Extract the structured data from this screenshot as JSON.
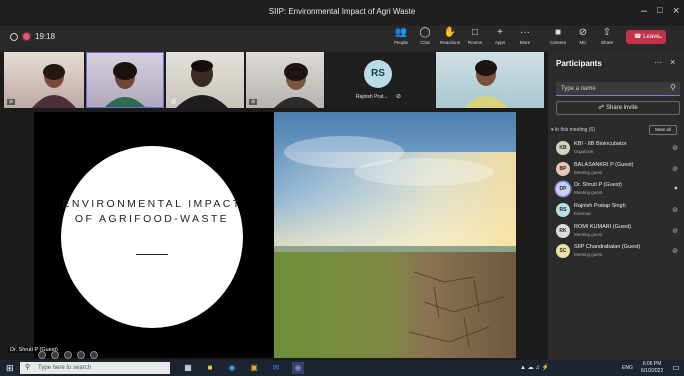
{
  "window": {
    "title": "SIIP: Environmental Impact of Agri Waste"
  },
  "toolbar": {
    "timer": "19:18",
    "buttons": [
      {
        "label": "People",
        "icon": "people-icon"
      },
      {
        "label": "Chat",
        "icon": "chat-icon"
      },
      {
        "label": "Reactions",
        "icon": "reactions-icon"
      },
      {
        "label": "Rooms",
        "icon": "rooms-icon"
      },
      {
        "label": "Apps",
        "icon": "apps-icon"
      },
      {
        "label": "More",
        "icon": "more-icon"
      },
      {
        "label": "Camera",
        "icon": "camera-icon"
      },
      {
        "label": "Mic",
        "icon": "mic-icon"
      },
      {
        "label": "Share",
        "icon": "share-icon"
      }
    ],
    "leave_label": "Leave"
  },
  "gallery": [
    {
      "name": "",
      "initials": ""
    },
    {
      "name": "",
      "initials": ""
    },
    {
      "name": "",
      "initials": ""
    },
    {
      "name": "",
      "initials": ""
    },
    {
      "name": "Rajnish Prat...",
      "initials": "RS"
    },
    {
      "name": "",
      "initials": ""
    }
  ],
  "slide": {
    "title": "ENVIRONMENTAL IMPACT OF AGRIFOOD-WASTE"
  },
  "presenter": {
    "name": "Dr. Shruti P (Guest)"
  },
  "participants": {
    "header": "Participants",
    "search_placeholder": "Type a name",
    "share_invite": "Share invite",
    "in_meeting": "In this meeting (6)",
    "mute_all": "Mute all",
    "list": [
      {
        "initials": "KB",
        "name": "KBI - IIB Bioincubator",
        "role": "Organizer",
        "color": "#c9d9c2"
      },
      {
        "initials": "BP",
        "name": "BALASANKRI P (Guest)",
        "role": "Meeting guest",
        "color": "#e8c7b4"
      },
      {
        "initials": "DP",
        "name": "Dr. Shruti P (Guest)",
        "role": "Meeting guest",
        "color": "#c8cfee"
      },
      {
        "initials": "RS",
        "name": "Rajnish Pratap Singh",
        "role": "External",
        "color": "#b9dde6"
      },
      {
        "initials": "RK",
        "name": "ROMI KUMARI (Guest)",
        "role": "Meeting guest",
        "color": "#dcdcdc"
      },
      {
        "initials": "SC",
        "name": "SIIP Chandrabalan (Guest)",
        "role": "Meeting guest",
        "color": "#efe1a6"
      }
    ]
  },
  "taskbar": {
    "search_placeholder": "Type here to search",
    "lang": "ENG",
    "time": "6:06 PM",
    "date": "6/10/2022"
  }
}
